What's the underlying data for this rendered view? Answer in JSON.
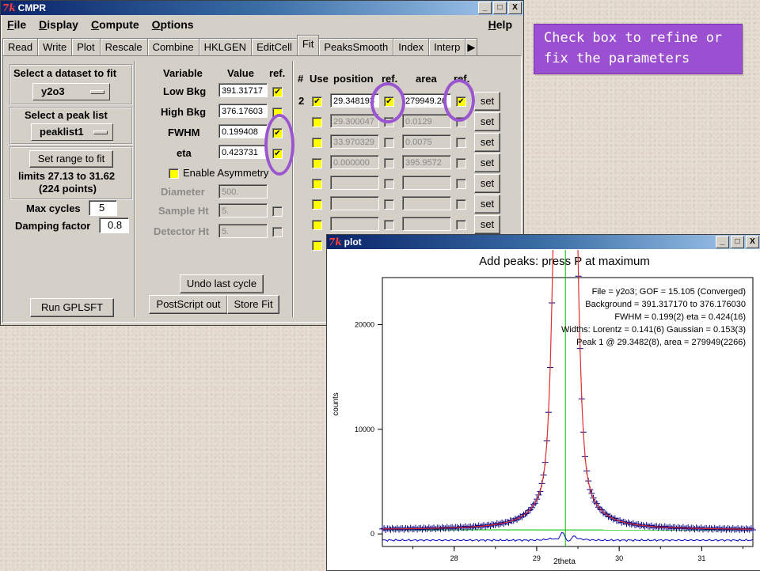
{
  "cmpr": {
    "title": "CMPR",
    "tk": "7k",
    "controls": [
      "_",
      "□",
      "X"
    ],
    "menus": [
      {
        "label": "File",
        "u": "F",
        "rest": "ile"
      },
      {
        "label": "Display",
        "u": "D",
        "rest": "isplay"
      },
      {
        "label": "Compute",
        "u": "C",
        "rest": "ompute"
      },
      {
        "label": "Options",
        "u": "O",
        "rest": "ptions"
      }
    ],
    "help": {
      "u": "H",
      "rest": "elp"
    },
    "tabs": [
      "Read",
      "Write",
      "Plot",
      "Rescale",
      "Combine",
      "HKLGEN",
      "EditCell",
      "Fit",
      "PeaksSmooth",
      "Index",
      "Interp"
    ],
    "tab_arrow": "▶",
    "active_tab": "Fit"
  },
  "left": {
    "dataset_label": "Select a dataset to fit",
    "dataset_value": "y2o3",
    "peaklist_label": "Select a peak list",
    "peaklist_value": "peaklist1",
    "set_range_button": "Set range to fit",
    "limits_text": "limits 27.13 to 31.62",
    "points_text": "(224 points)",
    "max_cycles_label": "Max cycles",
    "max_cycles_value": "5",
    "damping_label": "Damping factor",
    "damping_value": "0.8",
    "run_button": "Run GPLSFT"
  },
  "middle": {
    "headers": {
      "variable": "Variable",
      "value": "Value",
      "ref": "ref."
    },
    "rows": [
      {
        "label": "Low Bkg",
        "value": "391.31717",
        "ref": "✔",
        "enabled": true
      },
      {
        "label": "High Bkg",
        "value": "376.17603",
        "ref": "",
        "enabled": true
      },
      {
        "label": "FWHM",
        "value": "0.199408",
        "ref": "✔",
        "enabled": true
      },
      {
        "label": "eta",
        "value": "0.423731",
        "ref": "✔",
        "enabled": true
      }
    ],
    "asym_label": "Enable Asymmetry",
    "asym_rows": [
      {
        "label": "Diameter",
        "value": "500."
      },
      {
        "label": "Sample Ht",
        "value": "5."
      },
      {
        "label": "Detector Ht",
        "value": "5."
      }
    ],
    "undo_button": "Undo last cycle",
    "postscript_button": "PostScript out",
    "store_button": "Store Fit"
  },
  "peaks": {
    "headers": {
      "num": "#",
      "use": "Use",
      "position": "position",
      "ref": "ref.",
      "area": "area",
      "ref2": "ref."
    },
    "row_number": "2",
    "check": "✔",
    "rows": [
      {
        "position": "29.348193",
        "area": "279949.26",
        "use": true,
        "ref_pos": true,
        "ref_area": true,
        "active": true,
        "set": "set"
      },
      {
        "position": "29.300047",
        "area": "0.0129",
        "use": false,
        "ref_pos": false,
        "ref_area": false,
        "active": false,
        "set": "set"
      },
      {
        "position": "33.970329",
        "area": "0.0075",
        "use": false,
        "ref_pos": false,
        "ref_area": false,
        "active": false,
        "set": "set"
      },
      {
        "position": "0.000000",
        "area": "395.9572",
        "use": false,
        "ref_pos": false,
        "ref_area": false,
        "active": false,
        "set": "set"
      },
      {
        "position": "",
        "area": "",
        "use": false,
        "ref_pos": false,
        "ref_area": false,
        "active": false,
        "set": "set"
      },
      {
        "position": "",
        "area": "",
        "use": false,
        "ref_pos": false,
        "ref_area": false,
        "active": false,
        "set": "set"
      },
      {
        "position": "",
        "area": "",
        "use": false,
        "ref_pos": false,
        "ref_area": false,
        "active": false,
        "set": "set"
      },
      {
        "position": "",
        "area": "",
        "use": false,
        "ref_pos": false,
        "ref_area": false,
        "active": false,
        "set": ""
      }
    ]
  },
  "note": {
    "text": "Check box to refine or fix the parameters"
  },
  "plot": {
    "title": "plot",
    "tk": "7k",
    "controls": [
      "_",
      "□",
      "X"
    ],
    "colors": {
      "fit": "#e03030",
      "obs": "#000080",
      "diff": "#0000c0",
      "bkg": "#00c000",
      "marker": "#00c000"
    },
    "chart_data": {
      "type": "scatter",
      "title": "Add peaks: press P at maximum",
      "xlabel": "2theta",
      "ylabel": "counts",
      "xlim": [
        27.13,
        31.62
      ],
      "ylim": [
        -1200,
        24500
      ],
      "xticks": [
        28,
        29,
        30,
        31
      ],
      "yticks": [
        0,
        10000,
        20000
      ],
      "annotations": [
        "File = y2o3; GOF = 15.105 (Converged)",
        "Background = 391.317170 to 376.176030",
        "FWHM = 0.199(2) eta = 0.424(16)",
        "Widths: Lorentz = 0.141(6) Gaussian = 0.153(3)",
        "Peak 1 @ 29.3482(8), area = 279949(2266)"
      ],
      "peak": {
        "position": 29.3482,
        "area": 279949,
        "fwhm": 0.199,
        "eta": 0.424
      },
      "background": [
        391.31717,
        376.17603
      ],
      "diff_offset": -600,
      "n_points": 224
    }
  }
}
